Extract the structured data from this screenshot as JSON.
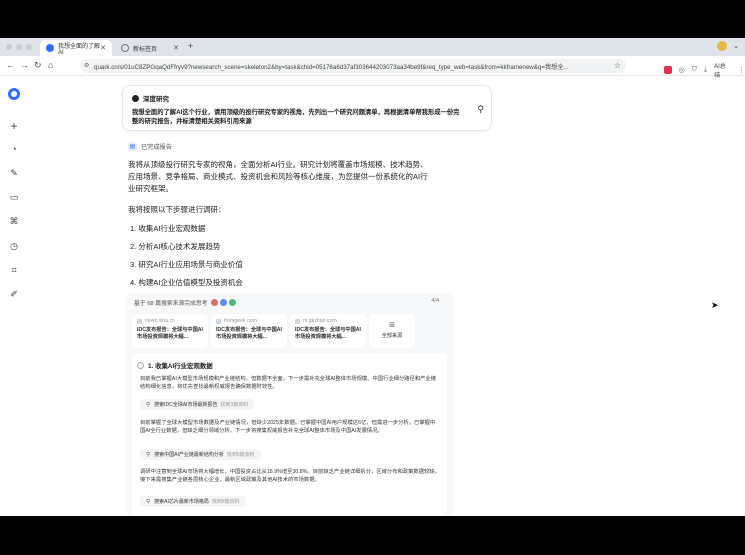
{
  "browser": {
    "tabs": [
      {
        "label": "我想全面的了解AI",
        "active": true
      },
      {
        "label": "新标签页",
        "active": false
      }
    ],
    "url": "quark.cn/s/01uC8ZPGqaQdFfryv9?newsearch_scene=skeleton2&by=task&chid=05176a6d37af303644203073aa34be9f&req_type_web=task&from=kkframenew&q=我想全...",
    "ai_label": "AI总结"
  },
  "query": {
    "mode": "深度研究",
    "text": "我想全面的了解AI这个行业，请用顶级的投行研究专家的视角，先列出一个研究问题清单，再根据清单帮我形成一份完整的研究报告，并标清楚相关资料引用来源"
  },
  "status": "已完成报告",
  "answer": {
    "intro": "我将从顶级投行研究专家的视角，全面分析AI行业。研究计划将覆盖市场规模、技术趋势、应用场景、竞争格局、商业模式、投资机会和风险等核心维度，为您提供一份系统化的AI行业研究框架。",
    "lead": "我将按照以下步骤进行调研：",
    "steps": [
      "1. 收集AI行业宏观数据",
      "2. 分析AI核心技术发展趋势",
      "3. 研究AI行业应用场景与商业价值",
      "4. 构建AI企业估值模型及投资机会"
    ]
  },
  "references": {
    "header": "基于 68 篇搜索来源完成思考",
    "page": "4/4",
    "cards": [
      {
        "source": "news.sina.cn",
        "title": "IDC发布报告：全球与中国AI市场投资规模将大幅..."
      },
      {
        "source": "fromgeek.com",
        "title": "IDC发布报告：全球与中国AI市场投资规模将大幅..."
      },
      {
        "source": "m.gkzhan.com",
        "title": "IDC发布报告：全球与中国AI市场投资规模将大幅..."
      }
    ],
    "all_label": "全部来源"
  },
  "detail": {
    "title": "1. 收集AI行业宏观数据",
    "p1": "目前我已掌握AI大模型市场规模和产业链结构，但数据不全面。下一步需补充全球AI整体市场规模、中国行业细分路径和产业链结构细化信息，将优先查找最新权威报告确保数据时效性。",
    "search1": "搜索IDC全球AI市场最新报告",
    "search1_count": "找到3篇资料",
    "p2": "目前掌握了全球大模型市场数据及产业链情况，但缺少2025年数据。已掌握中国AI用户规模达6亿，但需进一步分析。已掌握中国AI全行业数据，但缺乏细分领域分析。下一步将搜集权威报告补充全球AI整体市场及中国AI发展情况。",
    "search2": "搜索中国AI产业链最新结构分析",
    "search2_count": "找到5篇资料",
    "p3": "调研中注意到全球AI市场将大幅增长，中国投资占比从18.9%增至30.8%。目前缺乏产业链详细拆分，区域分布和政策数据较缺，接下来需搜集产业链各层核心企业、最新区域政策及其他AI技术的市场数据。",
    "search3": "搜索AI芯片最新市场格局",
    "search3_count": "找到8篇资料"
  },
  "colors": {
    "accent": "#2f6bff",
    "tab_bg": "#dfe3ea"
  }
}
